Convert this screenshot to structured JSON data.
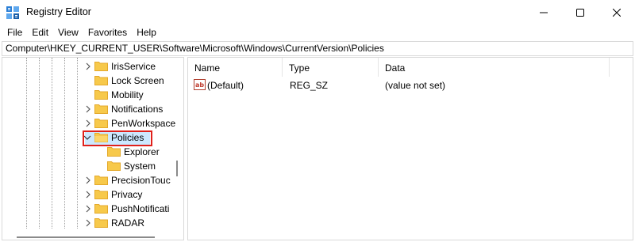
{
  "window": {
    "title": "Registry Editor",
    "controls": {
      "minimize": "—",
      "maximize": "☐",
      "close": "✕"
    }
  },
  "menu": [
    "File",
    "Edit",
    "View",
    "Favorites",
    "Help"
  ],
  "address": "Computer\\HKEY_CURRENT_USER\\Software\\Microsoft\\Windows\\CurrentVersion\\Policies",
  "tree": {
    "items": [
      {
        "label": "IrisService",
        "expandable": true,
        "expanded": false
      },
      {
        "label": "Lock Screen",
        "expandable": false,
        "expanded": false
      },
      {
        "label": "Mobility",
        "expandable": false,
        "expanded": false
      },
      {
        "label": "Notifications",
        "expandable": true,
        "expanded": false
      },
      {
        "label": "PenWorkspace",
        "expandable": true,
        "expanded": false
      },
      {
        "label": "Policies",
        "expandable": true,
        "expanded": true,
        "selected": true
      },
      {
        "label": "Explorer",
        "expandable": false,
        "child": true
      },
      {
        "label": "System",
        "expandable": false,
        "child": true
      },
      {
        "label": "PrecisionTouc",
        "expandable": true,
        "expanded": false
      },
      {
        "label": "Privacy",
        "expandable": true,
        "expanded": false
      },
      {
        "label": "PushNotificati",
        "expandable": true,
        "expanded": false
      },
      {
        "label": "RADAR",
        "expandable": true,
        "expanded": false
      }
    ]
  },
  "list": {
    "columns": [
      "Name",
      "Type",
      "Data"
    ],
    "rows": [
      {
        "name": "(Default)",
        "type": "REG_SZ",
        "data": "(value not set)",
        "icon": "string-value-icon"
      }
    ]
  },
  "colors": {
    "selection": "#cce8ff",
    "highlight_box": "#e0201b",
    "folder": "#f7c94b",
    "folder_dark": "#e4a92b"
  }
}
